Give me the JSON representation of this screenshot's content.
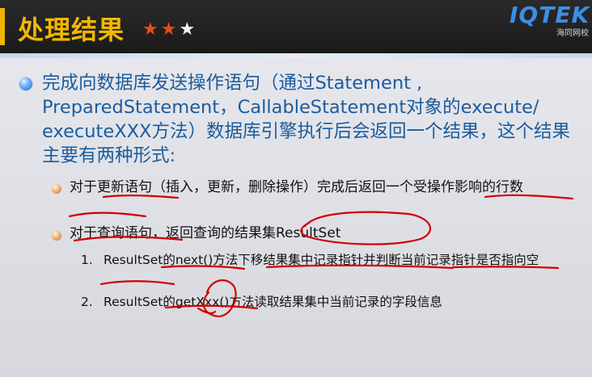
{
  "header": {
    "title": "处理结果",
    "stars": [
      "★",
      "★",
      "★"
    ],
    "star_states": [
      "filled",
      "filled",
      "empty"
    ],
    "logo_text": "IQTEK",
    "logo_sub": "海同网校"
  },
  "colors": {
    "title": "#f2b800",
    "main_text": "#1b5c9d",
    "annotation": "#d00000",
    "header_bg": "#1a1a1a"
  },
  "content": {
    "main_bullet": "完成向数据库发送操作语句（通过Statement , PreparedStatement，CallableStatement对象的execute/ executeXXX方法）数据库引擎执行后会返回一个结果，这个结果主要有两种形式:",
    "sub_bullets": [
      "对于更新语句（插入，更新，删除操作）完成后返回一个受操作影响的行数",
      "对于查询语句，返回查询的结果集ResultSet"
    ],
    "numbered": [
      {
        "num": "1.",
        "text": "ResultSet的next()方法下移结果集中记录指针并判断当前记录指针是否指向空"
      },
      {
        "num": "2.",
        "text": "ResultSet的getXxx()方法读取结果集中当前记录的字段信息"
      }
    ]
  }
}
